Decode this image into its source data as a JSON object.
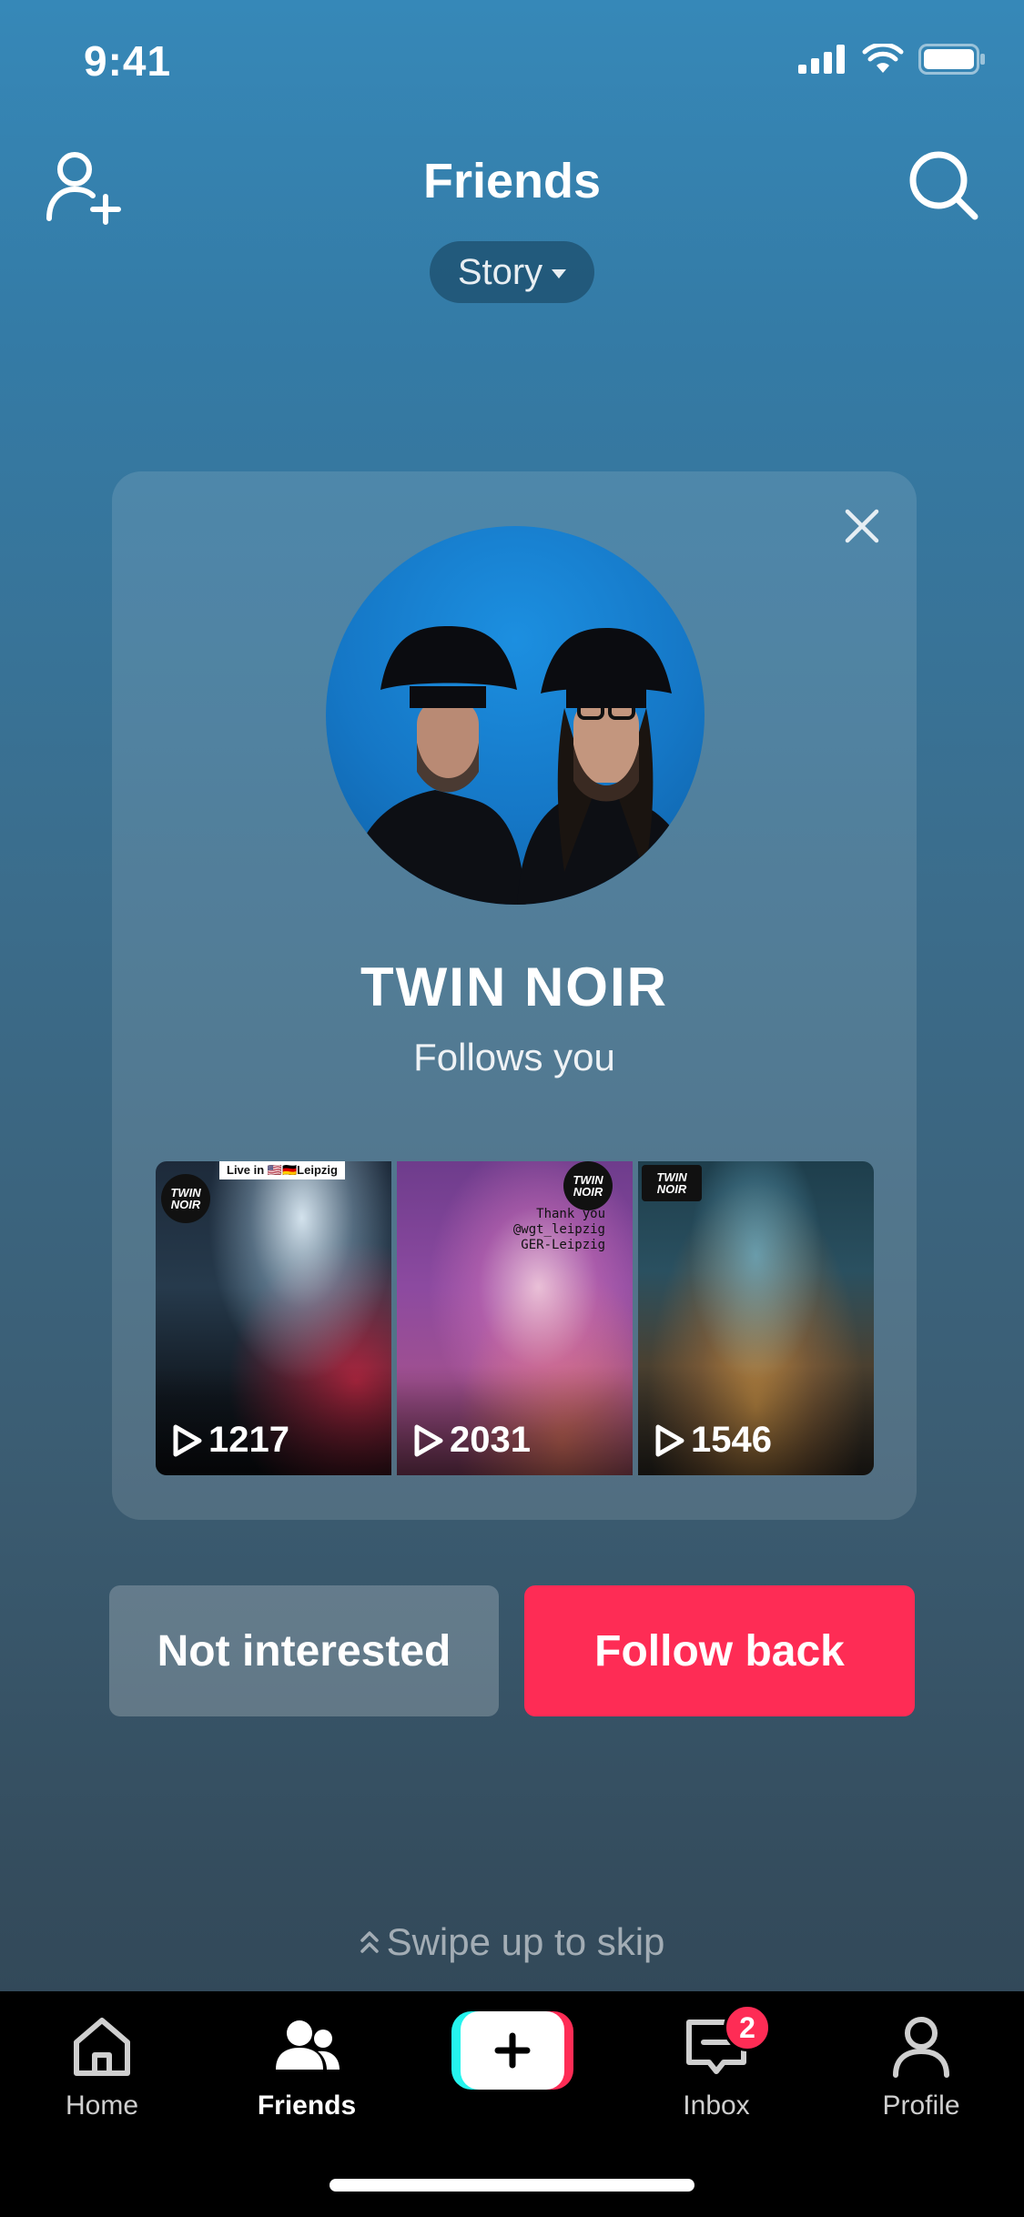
{
  "status_bar": {
    "time": "9:41"
  },
  "header": {
    "title": "Friends",
    "story_filter": "Story"
  },
  "card": {
    "name": "TWIN NOIR",
    "subtitle": "Follows you",
    "videos": [
      {
        "views": "1217",
        "overlay_tag": "Live in 🇺🇸🇩🇪Leipzig",
        "badge": "TWIN NOIR"
      },
      {
        "views": "2031",
        "overlay_lines": [
          "Thank you",
          "@wgt_leipzig",
          "GER-Leipzig"
        ],
        "badge": "TWIN NOIR"
      },
      {
        "views": "1546",
        "badge": "TWIN NOIR"
      }
    ]
  },
  "actions": {
    "not_interested": "Not interested",
    "follow_back": "Follow back"
  },
  "hint": {
    "swipe": "Swipe up to skip"
  },
  "tabbar": {
    "home": "Home",
    "friends": "Friends",
    "inbox": "Inbox",
    "inbox_badge": "2",
    "profile": "Profile"
  },
  "colors": {
    "accent": "#fe2c55",
    "create_cyan": "#25f4ee"
  }
}
